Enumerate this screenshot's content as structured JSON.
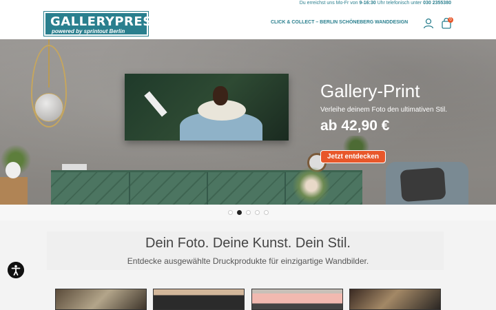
{
  "topbar": {
    "text_prefix": "Du erreichst uns Mo-Fr von ",
    "hours": "9-16:30",
    "text_middle": " Uhr telefonisch unter ",
    "phone": "030 2355380"
  },
  "header": {
    "logo_title": "GALLERYPRESS",
    "logo_sub": "powered by sprintout Berlin",
    "nav": [
      {
        "label": "CLICK & COLLECT – BERLIN SCHÖNEBERG"
      },
      {
        "label": "WANDDESIGN"
      }
    ],
    "cart_count": "0",
    "icons": {
      "account": "user-icon",
      "cart": "shopping-bag-icon"
    }
  },
  "hero": {
    "title": "Gallery-Print",
    "subtitle": "Verleihe deinem Foto den ultimativen Stil.",
    "price": "ab 42,90 €",
    "cta": "Jetzt entdecken"
  },
  "carousel": {
    "count": 5,
    "active_index": 1
  },
  "intro": {
    "title": "Dein Foto. Deine Kunst. Dein Stil.",
    "subtitle": "Entdecke ausgewählte Druckprodukte für einzigartige Wandbilder."
  },
  "colors": {
    "accent": "#2a7f8e",
    "cta": "#e8572a"
  },
  "accessibility": {
    "icon": "accessibility-icon"
  }
}
